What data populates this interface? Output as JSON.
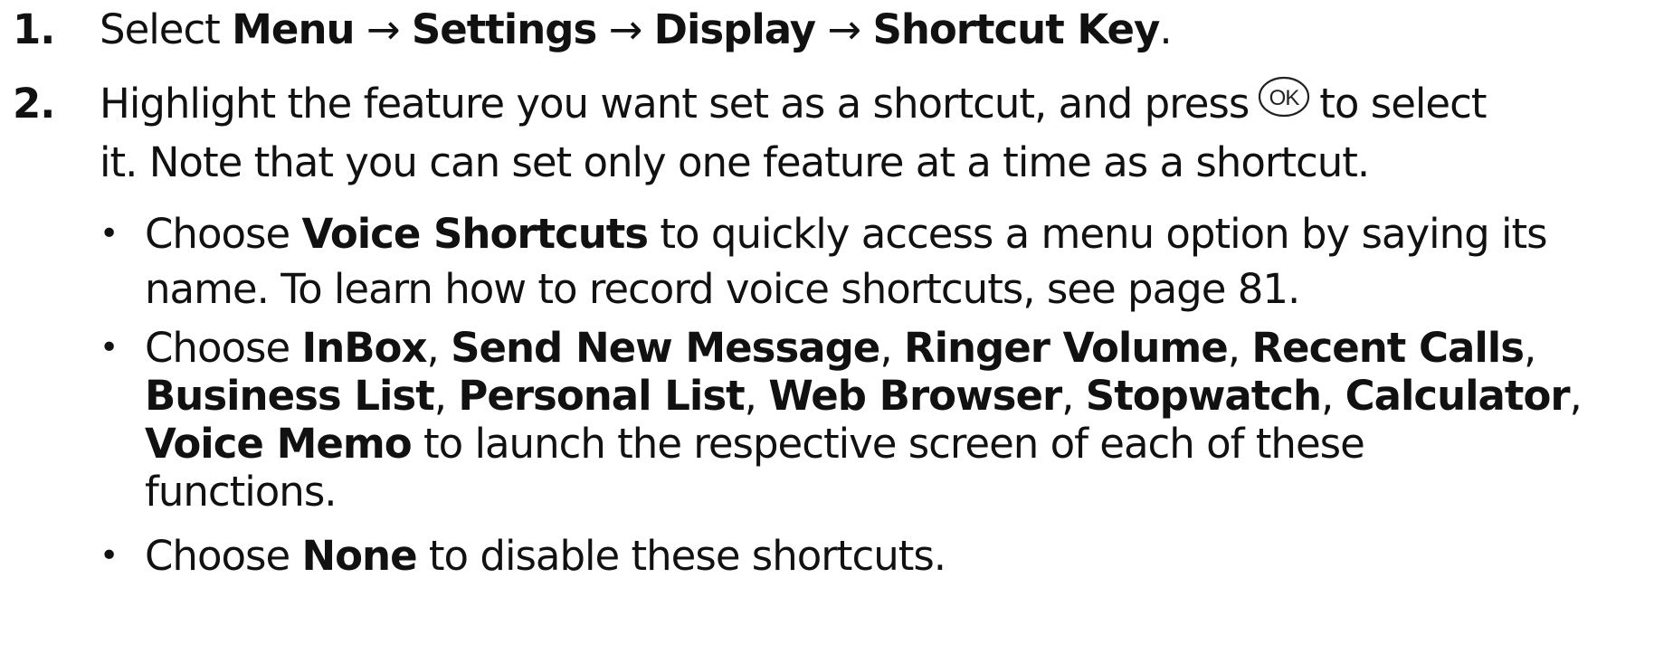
{
  "steps": [
    {
      "number": "1.",
      "lines": [
        {
          "parts": [
            {
              "text": "Select ",
              "bold": false
            },
            {
              "text": "Menu",
              "bold": true
            },
            {
              "text": " → ",
              "bold": false
            },
            {
              "text": "Settings",
              "bold": true
            },
            {
              "text": " → ",
              "bold": false
            },
            {
              "text": "Display",
              "bold": true
            },
            {
              "text": " → ",
              "bold": false
            },
            {
              "text": "Shortcut Key",
              "bold": true
            },
            {
              "text": ".",
              "bold": false
            }
          ]
        }
      ]
    },
    {
      "number": "2.",
      "line1_before": "Highlight the feature you want set as a shortcut, and press",
      "ok_icon": "ok-key-icon",
      "line1_after": "to select",
      "line2": "it. Note that you can set only one feature at a time as a shortcut."
    }
  ],
  "bullets": [
    {
      "lines": [
        [
          {
            "text": "Choose ",
            "bold": false
          },
          {
            "text": "Voice Shortcuts",
            "bold": true
          },
          {
            "text": " to quickly access a menu option by saying its",
            "bold": false
          }
        ],
        [
          {
            "text": "name. To learn how to record voice shortcuts, see page 81.",
            "bold": false
          }
        ]
      ]
    },
    {
      "lines": [
        [
          {
            "text": "Choose ",
            "bold": false
          },
          {
            "text": "InBox",
            "bold": true
          },
          {
            "text": ", ",
            "bold": false
          },
          {
            "text": "Send New Message",
            "bold": true
          },
          {
            "text": ", ",
            "bold": false
          },
          {
            "text": "Ringer Volume",
            "bold": true
          },
          {
            "text": ", ",
            "bold": false
          },
          {
            "text": "Recent Calls",
            "bold": true
          },
          {
            "text": ",",
            "bold": false
          }
        ],
        [
          {
            "text": "Business List",
            "bold": true
          },
          {
            "text": ", ",
            "bold": false
          },
          {
            "text": "Personal List",
            "bold": true
          },
          {
            "text": ", ",
            "bold": false
          },
          {
            "text": "Web Browser",
            "bold": true
          },
          {
            "text": ", ",
            "bold": false
          },
          {
            "text": "Stopwatch",
            "bold": true
          },
          {
            "text": ", ",
            "bold": false
          },
          {
            "text": "Calculator",
            "bold": true
          },
          {
            "text": ",",
            "bold": false
          }
        ],
        [
          {
            "text": "Voice Memo",
            "bold": true
          },
          {
            "text": " to launch the respective screen of each of these",
            "bold": false
          }
        ],
        [
          {
            "text": "functions.",
            "bold": false
          }
        ]
      ]
    },
    {
      "lines": [
        [
          {
            "text": "Choose ",
            "bold": false
          },
          {
            "text": "None",
            "bold": true
          },
          {
            "text": " to disable these shortcuts.",
            "bold": false
          }
        ]
      ]
    }
  ],
  "bullet_glyph": "•"
}
